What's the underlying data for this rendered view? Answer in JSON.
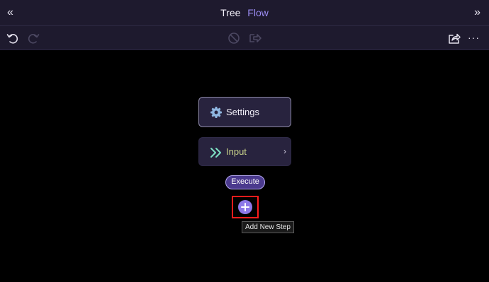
{
  "header": {
    "collapse_left_icon": "«",
    "collapse_right_icon": "»",
    "tabs": [
      {
        "label": "Tree"
      },
      {
        "label": "Flow"
      }
    ]
  },
  "toolbar": {
    "icons": [
      "undo-icon",
      "redo-icon",
      "disable-icon",
      "export-icon",
      "share-icon",
      "more-icon"
    ],
    "more_label": "···"
  },
  "flow": {
    "settings_label": "Settings",
    "input_label": "Input",
    "input_chevron": "›",
    "execute_label": "Execute",
    "add_step_tooltip": "Add New Step"
  },
  "colors": {
    "accent": "#9b8cf3",
    "panel_bg": "#1e1a2e",
    "card_bg": "#28233e",
    "input_label": "#c9d28a",
    "highlight": "#ff1c1c"
  }
}
